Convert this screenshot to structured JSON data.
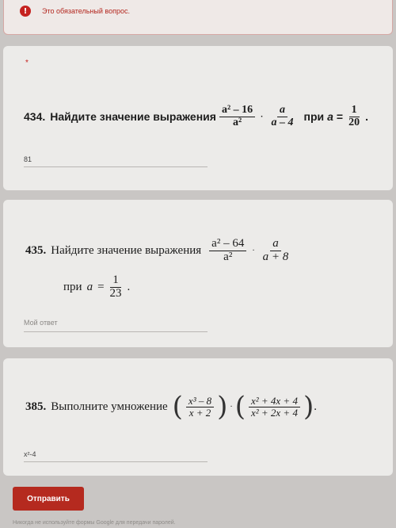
{
  "error_card": {
    "icon": "!",
    "text": "Это обязательный вопрос."
  },
  "q434": {
    "required_mark": "*",
    "number": "434.",
    "lead": "Найдите значение выражения",
    "f1_num": "a² – 16",
    "f1_den": "a²",
    "dot": "·",
    "f2_num": "a",
    "f2_den": "a – 4",
    "at": "при",
    "var": "a",
    "eq": "=",
    "f3_num": "1",
    "f3_den": "20",
    "end": ".",
    "answer": "81"
  },
  "q435": {
    "number": "435.",
    "lead": "Найдите значение выражения",
    "f1_num": "a² – 64",
    "f1_den": "a²",
    "dot": "·",
    "f2_num": "a",
    "f2_den": "a + 8",
    "at": "при",
    "var": "a",
    "eq": "=",
    "f3_num": "1",
    "f3_den": "23",
    "end": ".",
    "placeholder": "Мой ответ"
  },
  "q385": {
    "number": "385.",
    "lead": "Выполните умножение",
    "f1_num": "x³ – 8",
    "f1_den": "x + 2",
    "dot": "·",
    "f2_num": "x² + 4x + 4",
    "f2_den": "x² + 2x + 4",
    "end": ".",
    "answer": "x²-4"
  },
  "submit_label": "Отправить",
  "footer_text": "Никогда не используйте формы Google для передачи паролей."
}
